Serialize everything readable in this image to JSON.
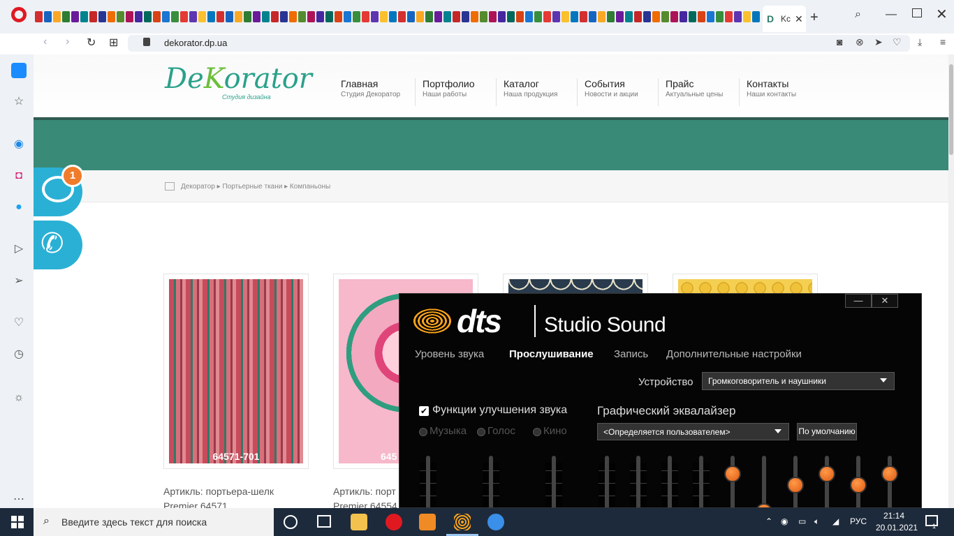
{
  "browser": {
    "active_tab_label": "Kc",
    "tab_favicon_colors": [
      "#d32f2f",
      "#1565c0",
      "#f9a825",
      "#2e7d32",
      "#6a1b9a",
      "#00838f",
      "#c62828",
      "#283593",
      "#ef6c00",
      "#558b2f",
      "#ad1457",
      "#4527a0",
      "#00695c",
      "#d84315",
      "#1976d2",
      "#388e3c",
      "#e53935",
      "#5e35b1",
      "#fbc02d",
      "#0277bd"
    ],
    "url": "dekorator.dp.ua"
  },
  "site": {
    "logo": {
      "part1": "De",
      "part2": "K",
      "part3": "orator",
      "subtitle": "Студия дизайна"
    },
    "nav": [
      {
        "title": "Главная",
        "subtitle": "Студия Декоратор"
      },
      {
        "title": "Портфолио",
        "subtitle": "Наши работы"
      },
      {
        "title": "Каталог",
        "subtitle": "Наша продукция"
      },
      {
        "title": "События",
        "subtitle": "Новости и акции"
      },
      {
        "title": "Прайс",
        "subtitle": "Актуальные цены"
      },
      {
        "title": "Контакты",
        "subtitle": "Наши контакты"
      }
    ],
    "breadcrumb": "Декоратор  ▸  Портьерные ткани  ▸  Компаньоны",
    "products": [
      {
        "code": "64571-701",
        "article_line1": "Артикль: портьера-шелк",
        "article_line2": "Premier 64571"
      },
      {
        "code": "645",
        "article_line1": "Артикль: порт",
        "article_line2": "Premier 64554"
      },
      {
        "code": "",
        "article_line1": "",
        "article_line2": ""
      },
      {
        "code": "",
        "article_line1": "",
        "article_line2": ""
      }
    ],
    "chat_badge": "1"
  },
  "dts": {
    "logo_word": "dts",
    "product": "Studio Sound",
    "tabs": [
      "Уровень звука",
      "Прослушивание",
      "Запись",
      "Дополнительные настройки"
    ],
    "device_label": "Устройство",
    "device_value": "Громкоговоритель и наушники",
    "enhancement_label": "Функции улучшения звука",
    "enhancement_checked": "✔",
    "modes": [
      "Музыка",
      "Голос",
      "Кино"
    ],
    "eq_title": "Графический эквалайзер",
    "preset_value": "<Определяется пользователем>",
    "default_button": "По умолчанию"
  },
  "taskbar": {
    "search_placeholder": "Введите здесь текст для поиска",
    "language": "РУС",
    "time": "21:14",
    "date": "20.01.2021",
    "notifications": "1"
  }
}
